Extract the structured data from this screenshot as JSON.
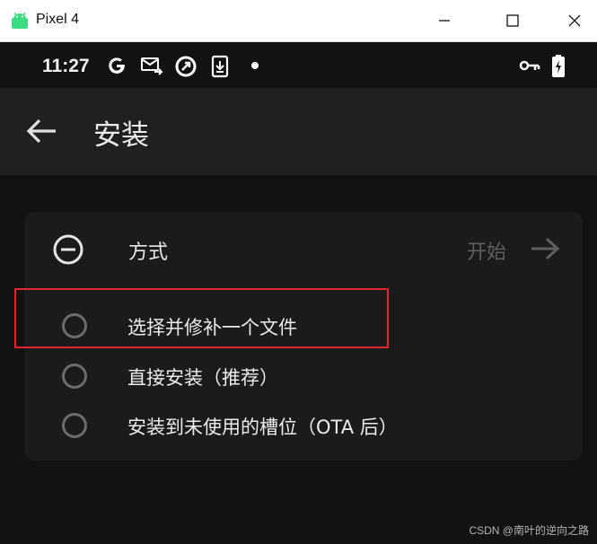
{
  "window": {
    "title": "Pixel 4"
  },
  "status_bar": {
    "time": "11:27",
    "left_icons": [
      "google-icon",
      "mail-forward-icon",
      "sync-icon",
      "download-icon",
      "notification-dot-icon"
    ],
    "right_icons": [
      "vpn-key-icon",
      "battery-charging-icon"
    ]
  },
  "app_bar": {
    "title": "安装",
    "back_icon": "arrow-left-icon"
  },
  "card": {
    "method_label": "方式",
    "start_label": "开始",
    "options": [
      {
        "label": "选择并修补一个文件",
        "selected": false
      },
      {
        "label": "直接安装（推荐）",
        "selected": false
      },
      {
        "label": "安装到未使用的槽位（OTA 后）",
        "selected": false
      }
    ]
  },
  "annotation": {
    "color": "#e0282c"
  },
  "watermark": "CSDN @南叶的逆向之路",
  "colors": {
    "background": "#121212",
    "app_bar": "#202020",
    "card": "#1b1b1b"
  }
}
